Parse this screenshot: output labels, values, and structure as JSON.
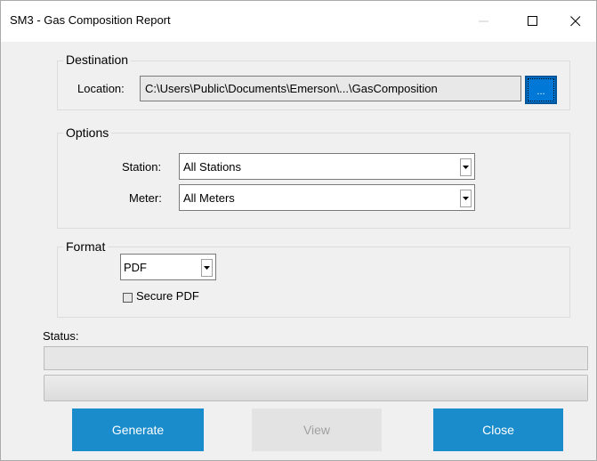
{
  "window": {
    "title": "SM3 - Gas Composition Report",
    "controls": {
      "minimize": "minimize-icon",
      "maximize": "maximize-icon",
      "close": "close-icon"
    }
  },
  "destination": {
    "group_label": "Destination",
    "location_label": "Location:",
    "location_value": "C:\\Users\\Public\\Documents\\Emerson\\...\\GasComposition",
    "browse_label": "..."
  },
  "options": {
    "group_label": "Options",
    "station_label": "Station:",
    "station_value": "All Stations",
    "meter_label": "Meter:",
    "meter_value": "All Meters"
  },
  "format": {
    "group_label": "Format",
    "format_value": "PDF",
    "secure_pdf_label": "Secure PDF",
    "secure_pdf_checked": false
  },
  "status": {
    "label": "Status:",
    "text": "",
    "progress": 0
  },
  "buttons": {
    "generate": "Generate",
    "view": "View",
    "close": "Close"
  },
  "colors": {
    "accent": "#1a8ccc",
    "browse": "#0078d7",
    "disabled_text": "#a0a0a0"
  }
}
